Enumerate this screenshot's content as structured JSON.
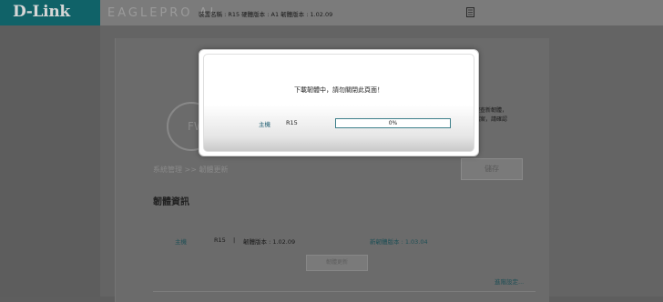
{
  "header": {
    "logo": "D-Link",
    "brand": "EAGLEPRO AI",
    "device_info": "裝置名稱 : R15 硬體版本 : A1 韌體版本 : 1.02.09",
    "doc_icon": "document-icon"
  },
  "background": {
    "firmware_icon_text": "FW",
    "right_text_line1": "搜查新韌體，",
    "right_text_line2": "檔案，請確認",
    "breadcrumb": "系統管理 >> 韌體更新",
    "save_label": "儲存",
    "section_title": "韌體資訊",
    "row": {
      "label": "主機",
      "model": "R15",
      "separator": "|",
      "version_text": "韌體版本 : 1.02.09",
      "new_version_text": "新韌體版本 : 1.03.04"
    },
    "check_button": "韌體更新",
    "advanced_link": "進階設定..."
  },
  "modal": {
    "message": "下載韌體中，請勿關閉此頁面！",
    "host_label": "主機",
    "model": "R15",
    "progress_percent": 0,
    "progress_text": "0%"
  },
  "colors": {
    "accent": "#3d7f8a",
    "logo_bg": "#106268"
  }
}
